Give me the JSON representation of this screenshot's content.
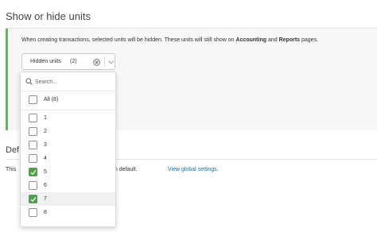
{
  "section": {
    "title": "Show or hide units",
    "info_prefix": "When creating transactions, selected units will be hidden. These units will still show on ",
    "info_bold1": "Accounting",
    "info_and": " and ",
    "info_bold2": "Reports",
    "info_suffix": " pages."
  },
  "select": {
    "label": "Hidden units",
    "count": "(2)"
  },
  "section2": {
    "title": "Def",
    "text_prefix": "This",
    "text_rest": "Buildium default.",
    "link": "View global settings."
  },
  "dropdown": {
    "search_placeholder": "Search...",
    "options": [
      {
        "label": "All (8)",
        "checked": false
      },
      {
        "label": "1",
        "checked": false
      },
      {
        "label": "2",
        "checked": false
      },
      {
        "label": "3",
        "checked": false
      },
      {
        "label": "4",
        "checked": false
      },
      {
        "label": "5",
        "checked": true
      },
      {
        "label": "6",
        "checked": false
      },
      {
        "label": "7",
        "checked": true
      },
      {
        "label": "8",
        "checked": false
      }
    ],
    "highlighted_index": 7
  },
  "colors": {
    "accent_green": "#4ea04a",
    "link_blue": "#1a6fb0"
  }
}
